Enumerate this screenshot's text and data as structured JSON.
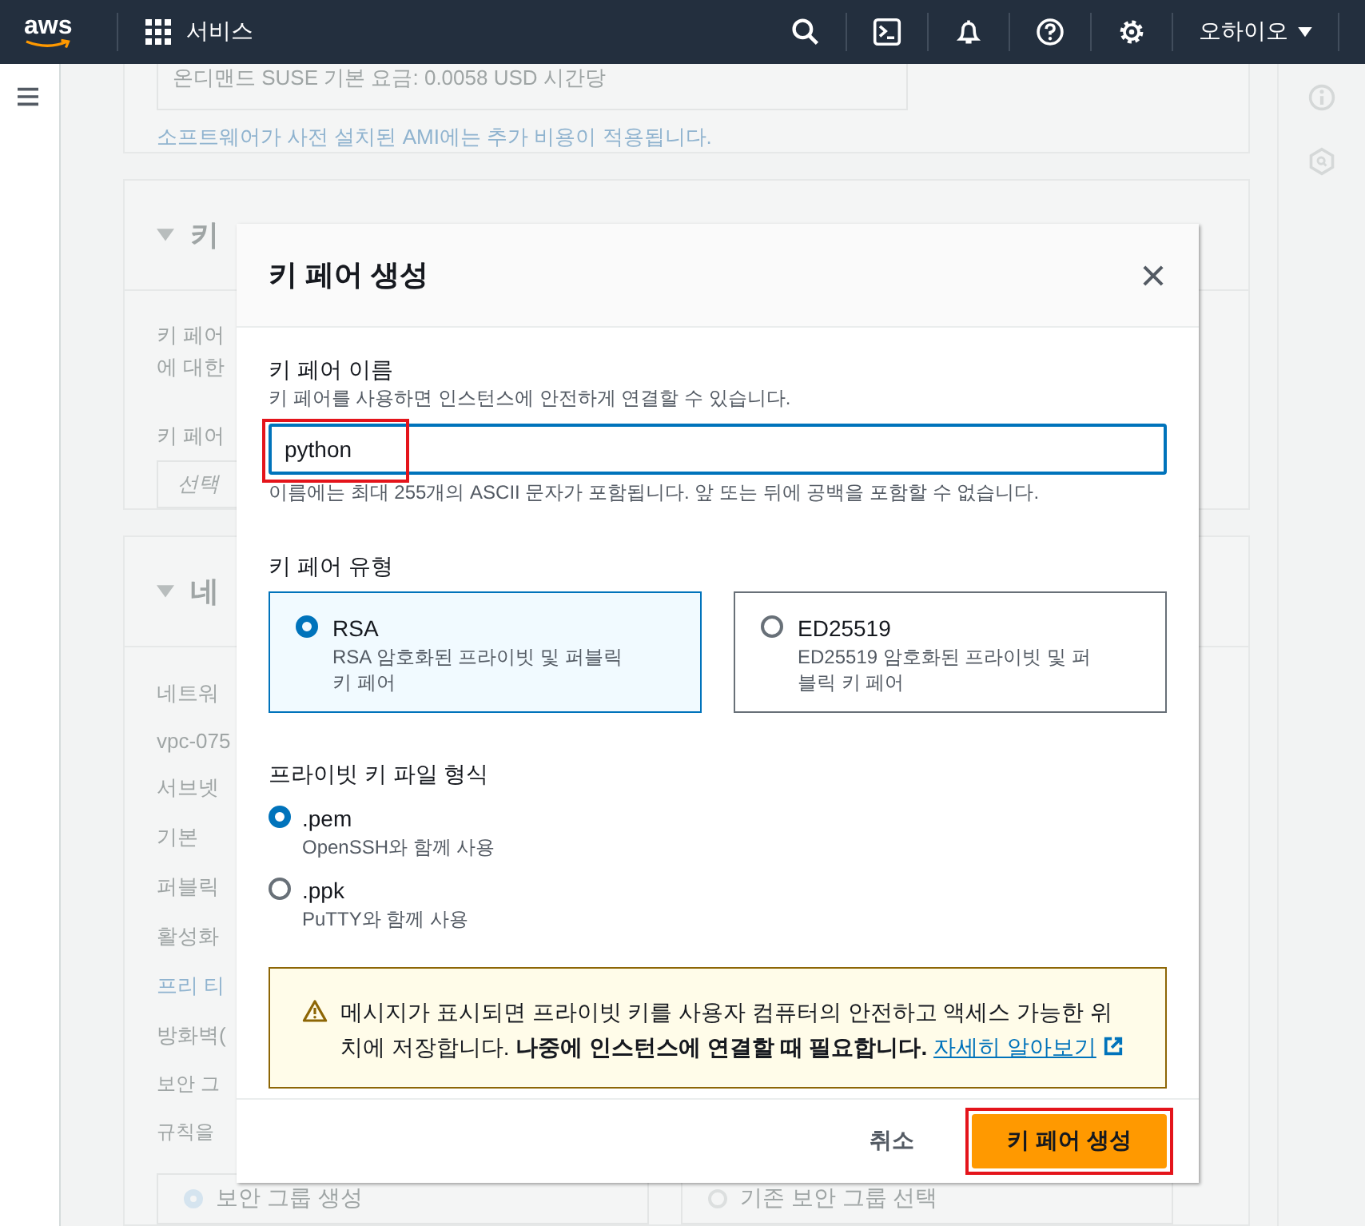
{
  "header": {
    "logo": "aws",
    "services": "서비스",
    "region": "오하이오"
  },
  "background": {
    "price_line": "온디맨드 SUSE 기본 요금: 0.0058 USD 시간당",
    "ami_note": "소프트웨어가 사전 설치된 AMI에는 추가 비용이 적용됩니다.",
    "key_card": {
      "title": "키",
      "lines": [
        "키 페어",
        "에 대한"
      ],
      "select_label": "키 페어",
      "select_placeholder": "선택"
    },
    "network_card": {
      "title": "네",
      "lines": [
        {
          "text": "네트워",
          "kind": "label"
        },
        {
          "text": "vpc-075",
          "kind": "value"
        },
        {
          "text": "서브넷",
          "kind": "label"
        },
        {
          "text": "기본",
          "kind": "value"
        },
        {
          "text": "퍼블릭",
          "kind": "label"
        },
        {
          "text": "활성화",
          "kind": "value"
        },
        {
          "text": "프리 티",
          "kind": "link"
        },
        {
          "text": "방화벽(",
          "kind": "label"
        },
        {
          "text": "보안 그",
          "kind": "small"
        },
        {
          "text": "규칙을",
          "kind": "small"
        }
      ],
      "sg_options": [
        {
          "label": "보안 그룹 생성",
          "selected": true
        },
        {
          "label": "기존 보안 그룹 선택",
          "selected": false
        }
      ]
    }
  },
  "modal": {
    "title": "키 페어 생성",
    "name_field": {
      "label": "키 페어 이름",
      "description": "키 페어를 사용하면 인스턴스에 안전하게 연결할 수 있습니다.",
      "value": "python",
      "hint": "이름에는 최대 255개의 ASCII 문자가 포함됩니다. 앞 또는 뒤에 공백을 포함할 수 없습니다.",
      "highlighted": true
    },
    "key_type": {
      "label": "키 페어 유형",
      "options": [
        {
          "title": "RSA",
          "description": "RSA 암호화된 프라이빗 및 퍼블릭 키 페어",
          "selected": true
        },
        {
          "title": "ED25519",
          "description": "ED25519 암호화된 프라이빗 및 퍼블릭 키 페어",
          "selected": false
        }
      ]
    },
    "file_format": {
      "label": "프라이빗 키 파일 형식",
      "options": [
        {
          "title": ".pem",
          "description": "OpenSSH와 함께 사용",
          "selected": true
        },
        {
          "title": ".ppk",
          "description": "PuTTY와 함께 사용",
          "selected": false
        }
      ]
    },
    "alert": {
      "text": "메시지가 표시되면 프라이빗 키를 사용자 컴퓨터의 안전하고 액세스 가능한 위치에 저장합니다. **나중에 인스턴스에 연결할 때 필요합니다.**",
      "link": "자세히 알아보기"
    },
    "cancel": "취소",
    "create": {
      "label": "키 페어 생성",
      "highlighted": true
    }
  }
}
